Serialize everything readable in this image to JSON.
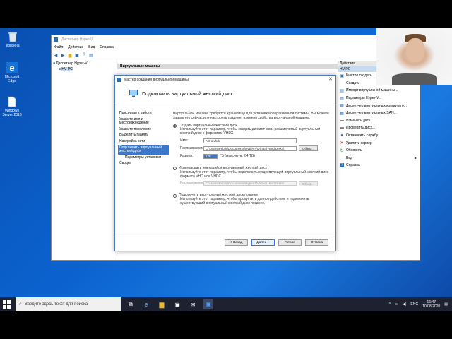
{
  "desktop": {
    "icons": [
      {
        "label": "Корзина",
        "icon": "recycle-bin-icon"
      },
      {
        "label": "Microsoft Edge",
        "icon": "edge-icon"
      },
      {
        "label": "Windows Server 2016",
        "icon": "document-icon"
      }
    ]
  },
  "hyperv": {
    "title": "Диспетчер Hyper-V",
    "menu": [
      "Файл",
      "Действие",
      "Вид",
      "Справка"
    ],
    "tree": [
      "Диспетчер Hyper-V",
      "HV-PC"
    ],
    "main_section": "Виртуальные машины",
    "actions_header": "Действия",
    "actions_sub": "HV-PC",
    "actions": [
      {
        "label": "Быстро создать...",
        "icon": "quick-create-icon",
        "arrow": false
      },
      {
        "label": "Создать",
        "icon": "",
        "arrow": true
      },
      {
        "label": "Импорт виртуальной машины...",
        "icon": "import-icon",
        "arrow": false
      },
      {
        "label": "Параметры Hyper-V...",
        "icon": "settings-icon",
        "arrow": false
      },
      {
        "label": "Диспетчер виртуальных коммутато...",
        "icon": "switch-manager-icon",
        "arrow": false
      },
      {
        "label": "Диспетчер виртуальных SAN...",
        "icon": "san-manager-icon",
        "arrow": false
      },
      {
        "label": "Изменить диск...",
        "icon": "edit-disk-icon",
        "arrow": false
      },
      {
        "label": "Проверить диск...",
        "icon": "inspect-disk-icon",
        "arrow": false
      },
      {
        "label": "Остановить службу",
        "icon": "stop-service-icon",
        "arrow": false
      },
      {
        "label": "Удалить сервер",
        "icon": "remove-server-icon",
        "arrow": false
      },
      {
        "label": "Обновить",
        "icon": "refresh-icon",
        "arrow": false
      },
      {
        "label": "Вид",
        "icon": "",
        "arrow": true
      },
      {
        "label": "Справка",
        "icon": "help-icon",
        "arrow": false
      }
    ]
  },
  "wizard": {
    "title": "Мастер создания виртуальной машины",
    "heading": "Подключить виртуальный жесткий диск",
    "nav": [
      {
        "label": "Приступая к работе",
        "active": false,
        "sub": false
      },
      {
        "label": "Укажите имя и местонахождение",
        "active": false,
        "sub": false
      },
      {
        "label": "Укажите поколение",
        "active": false,
        "sub": false
      },
      {
        "label": "Выделить память",
        "active": false,
        "sub": false
      },
      {
        "label": "Настройка сети",
        "active": false,
        "sub": false
      },
      {
        "label": "Подключить виртуальный жесткий диск",
        "active": true,
        "sub": false
      },
      {
        "label": "Параметры установки",
        "active": false,
        "sub": true
      },
      {
        "label": "Сводка",
        "active": false,
        "sub": false
      }
    ],
    "intro": "Виртуальной машине требуется хранилище для установки операционной системы. Вы можете задать его сейчас или настроить позднее, изменив свойства виртуальной машины.",
    "opt1": {
      "label": "Создать виртуальный жесткий диск",
      "desc": "Используйте этот параметр, чтобы создать динамически расширяемый виртуальный жесткий диск с форматом VHDX.",
      "name_label": "Имя:",
      "name_value": "AD-1.vhdx",
      "location_label": "Расположение:",
      "location_value": "C:\\Users\\Public\\Documents\\Hyper-V\\Virtual Hard Disks\\",
      "browse": "Обзор...",
      "size_label": "Размер:",
      "size_value": "128",
      "size_unit": "ГБ (максимум: 64 ТБ)"
    },
    "opt2": {
      "label": "Использовать имеющийся виртуальный жесткий диск",
      "desc": "Используйте этот параметр, чтобы подключить существующий виртуальный жесткий диск формата VHD или VHDX.",
      "location_label": "Расположение:",
      "location_value": "C:\\Users\\Public\\Documents\\Hyper-V\\Virtual Hard Disks\\",
      "browse": "Обзор..."
    },
    "opt3": {
      "label": "Подключить виртуальный жесткий диск позднее",
      "desc": "Используйте этот параметр, чтобы пропустить данное действие и подключить существующий виртуальный жесткий диск позднее."
    },
    "buttons": {
      "back": "< Назад",
      "next": "Далее >",
      "finish": "Готово",
      "cancel": "Отмена"
    }
  },
  "taskbar": {
    "search_placeholder": "Введите здесь текст для поиска",
    "language": "ENG",
    "time": "16:47",
    "date": "10.08.2020"
  },
  "colors": {
    "accent": "#3c78c8",
    "desktop": "#0b63d0",
    "taskbar": "#1e2230"
  }
}
